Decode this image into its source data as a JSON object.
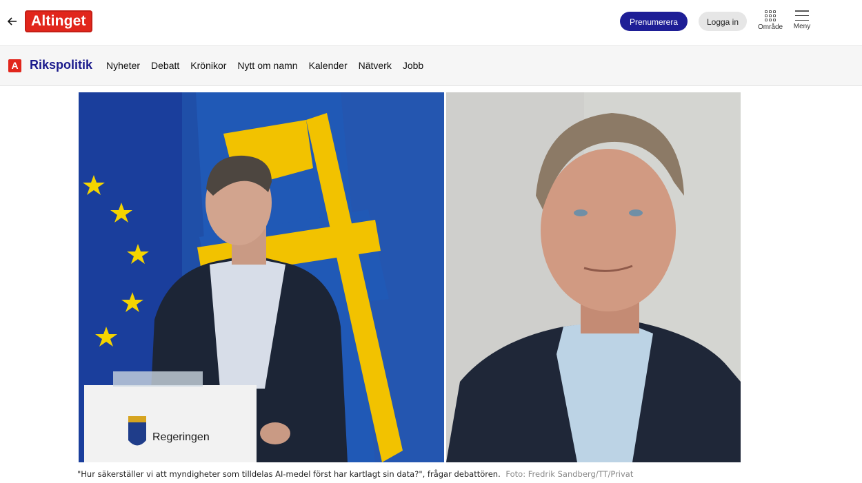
{
  "header": {
    "logo_text": "Altinget",
    "subscribe_label": "Prenumerera",
    "login_label": "Logga in",
    "area_label": "Område",
    "menu_label": "Meny",
    "back_icon": "arrow-left-icon"
  },
  "section": {
    "logo_letter": "A",
    "title": "Rikspolitik",
    "nav": [
      "Nyheter",
      "Debatt",
      "Krönikor",
      "Nytt om namn",
      "Kalender",
      "Nätverk",
      "Jobb"
    ]
  },
  "hero": {
    "lectern_text": "Regeringen"
  },
  "caption": {
    "text": "\"Hur säkerställer vi att myndigheter som tilldelas AI-medel först har kartlagt sin data?\", frågar debattören.",
    "credit": "Foto: Fredrik Sandberg/TT/Privat"
  },
  "colors": {
    "brand_red": "#e1261c",
    "brand_blue": "#1e1e96",
    "section_title": "#1a1a8c"
  }
}
